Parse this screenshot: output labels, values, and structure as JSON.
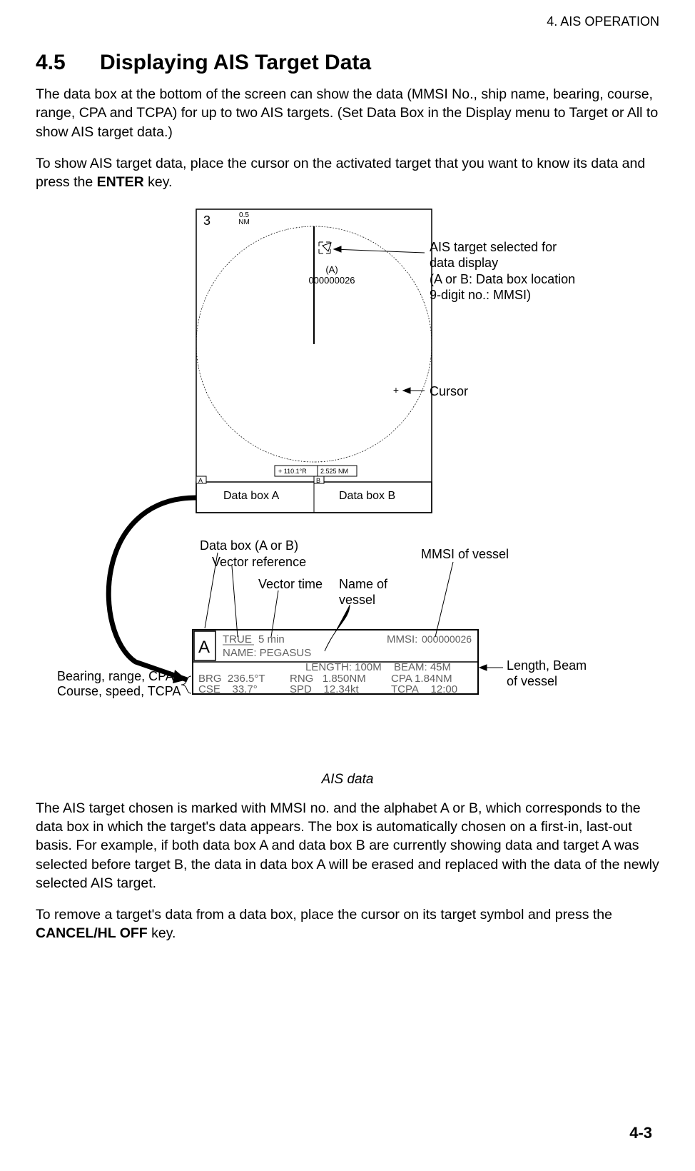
{
  "header": {
    "chapter": "4. AIS OPERATION"
  },
  "section": {
    "number": "4.5",
    "title": "Displaying AIS Target Data"
  },
  "para1": "The data box at the bottom of the screen can show the data (MMSI No., ship name, bearing, course, range, CPA and TCPA) for up to two AIS targets. (Set Data Box in the Display menu to Target or All to show AIS target data.)",
  "para2a": "To show AIS target data, place the cursor on the activated target that you want to know its data and press the ",
  "para2b": "ENTER",
  "para2c": " key.",
  "radar": {
    "corner": "3",
    "range": "0.5",
    "range_unit": "NM",
    "target_label": "(A)",
    "mmsi": "000000026",
    "cursor_glyph": "+",
    "readout_bearing": "+ 110.1°R",
    "readout_range": "2.525 NM",
    "box_a_tab": "A",
    "box_b_tab": "B",
    "box_a_label": "Data box A",
    "box_b_label": "Data box B"
  },
  "annot": {
    "target_sel": "AIS target selected for\ndata display\n(A or B: Data box location\n9-digit no.: MMSI)",
    "cursor": "Cursor",
    "databox": "Data box (A or B)",
    "vector_ref": "Vector reference",
    "vector_time": "Vector time",
    "name": "Name of\nvessel",
    "mmsi": "MMSI of vessel",
    "length_beam": "Length, Beam\nof vessel",
    "brg_line1": "Bearing, range, CPA",
    "brg_line2": "Course, speed, TCPA"
  },
  "databox": {
    "letter": "A",
    "vector_ref": "TRUE",
    "vector_time": "5 min",
    "mmsi_label": "MMSI:",
    "mmsi": "000000026",
    "name_label": "NAME:",
    "name": "PEGASUS",
    "length_label": "LENGTH:",
    "length": "100M",
    "beam_label": "BEAM:",
    "beam": "45M",
    "brg_label": "BRG",
    "brg": "236.5°T",
    "rng_label": "RNG",
    "rng": "1.850NM",
    "cpa_label": "CPA",
    "cpa": "1.84NM",
    "cse_label": "CSE",
    "cse": "33.7°",
    "spd_label": "SPD",
    "spd": "12.34kt",
    "tcpa_label": "TCPA",
    "tcpa": "12:00"
  },
  "caption": "AIS data",
  "para3": "The AIS target chosen is marked with MMSI no. and the alphabet A or B, which corresponds to the data box in which the target's data appears. The box is automatically chosen on a first-in, last-out basis. For example, if both data box A and data box B are currently showing data and target A was selected before target B, the data in data box A will be erased and replaced with the data of the newly selected AIS target.",
  "para4a": "To remove a target's data from a data box, place the cursor on its target symbol and press the ",
  "para4b": "CANCEL/HL OFF",
  "para4c": " key.",
  "page_num": "4-3"
}
